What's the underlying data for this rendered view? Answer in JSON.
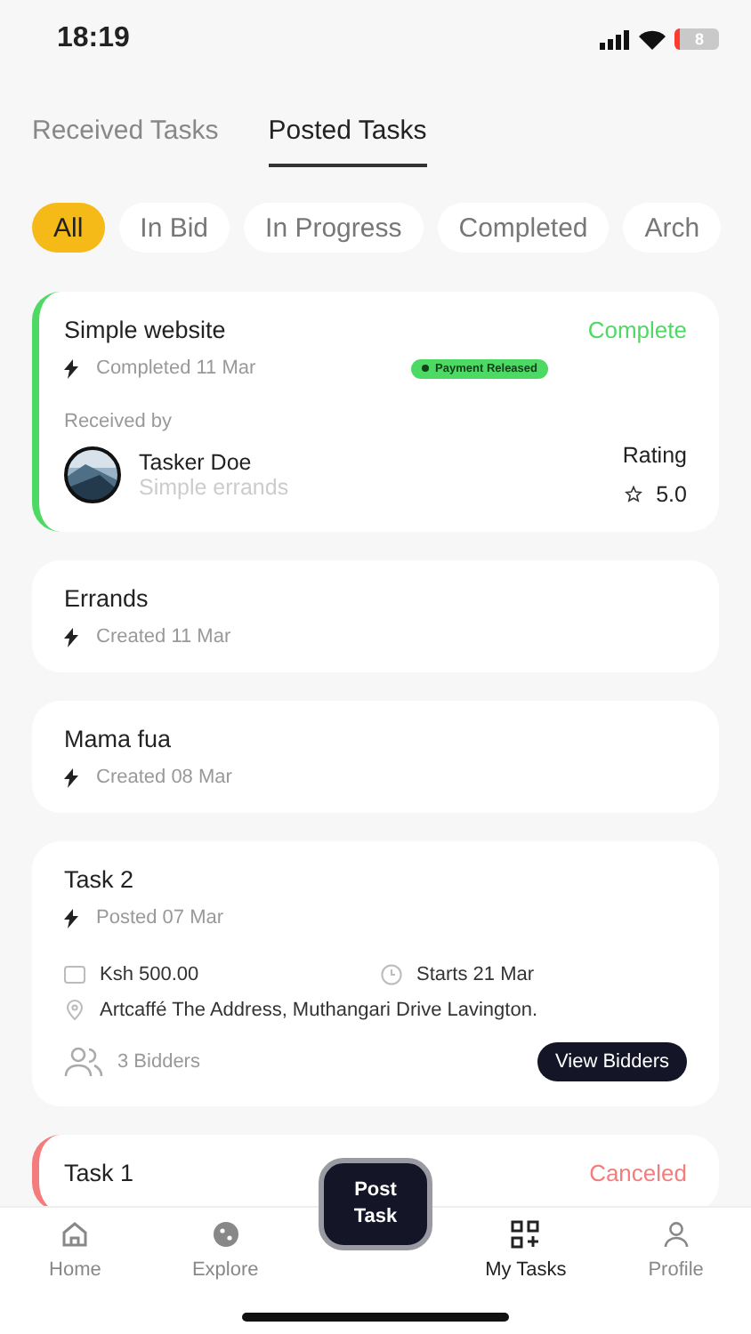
{
  "status_bar": {
    "time": "18:19",
    "battery": "8"
  },
  "tabs": [
    {
      "label": "Received Tasks",
      "selected": false
    },
    {
      "label": "Posted Tasks",
      "selected": true
    }
  ],
  "filters": [
    {
      "label": "All",
      "selected": true
    },
    {
      "label": "In Bid",
      "selected": false
    },
    {
      "label": "In Progress",
      "selected": false
    },
    {
      "label": "Completed",
      "selected": false
    },
    {
      "label": "Arch",
      "selected": false
    }
  ],
  "tasks": [
    {
      "kind": "completed",
      "title": "Simple website",
      "status": "Complete",
      "color": "#4cd964",
      "date": "Completed 11 Mar",
      "badge": "Payment Released",
      "received_by_label": "Received by",
      "tasker": {
        "name": "Tasker Doe",
        "subtitle": "Simple errands"
      },
      "rating_label": "Rating",
      "rating": "5.0"
    },
    {
      "kind": "plain",
      "title": "Errands",
      "date": "Created 11 Mar"
    },
    {
      "kind": "plain",
      "title": "Mama fua",
      "date": "Created 08 Mar"
    },
    {
      "kind": "detailed",
      "title": "Task 2",
      "date": "Posted 07 Mar",
      "price": "Ksh 500.00",
      "starts": "Starts 21 Mar",
      "location": "Artcaffé The Address, Muthangari Drive Lavington.",
      "bidders": "3 Bidders",
      "action": "View Bidders"
    },
    {
      "kind": "plain",
      "title": "Task 1",
      "status": "Canceled",
      "color": "#f47c7c"
    }
  ],
  "post_button": "Post\nTask",
  "nav": [
    {
      "kind": "home",
      "label": "Home",
      "selected": false
    },
    {
      "kind": "explore",
      "label": "Explore",
      "selected": false
    },
    {
      "kind": "gap"
    },
    {
      "kind": "tasks",
      "label": "My Tasks",
      "selected": true
    },
    {
      "kind": "profile",
      "label": "Profile",
      "selected": false
    }
  ]
}
